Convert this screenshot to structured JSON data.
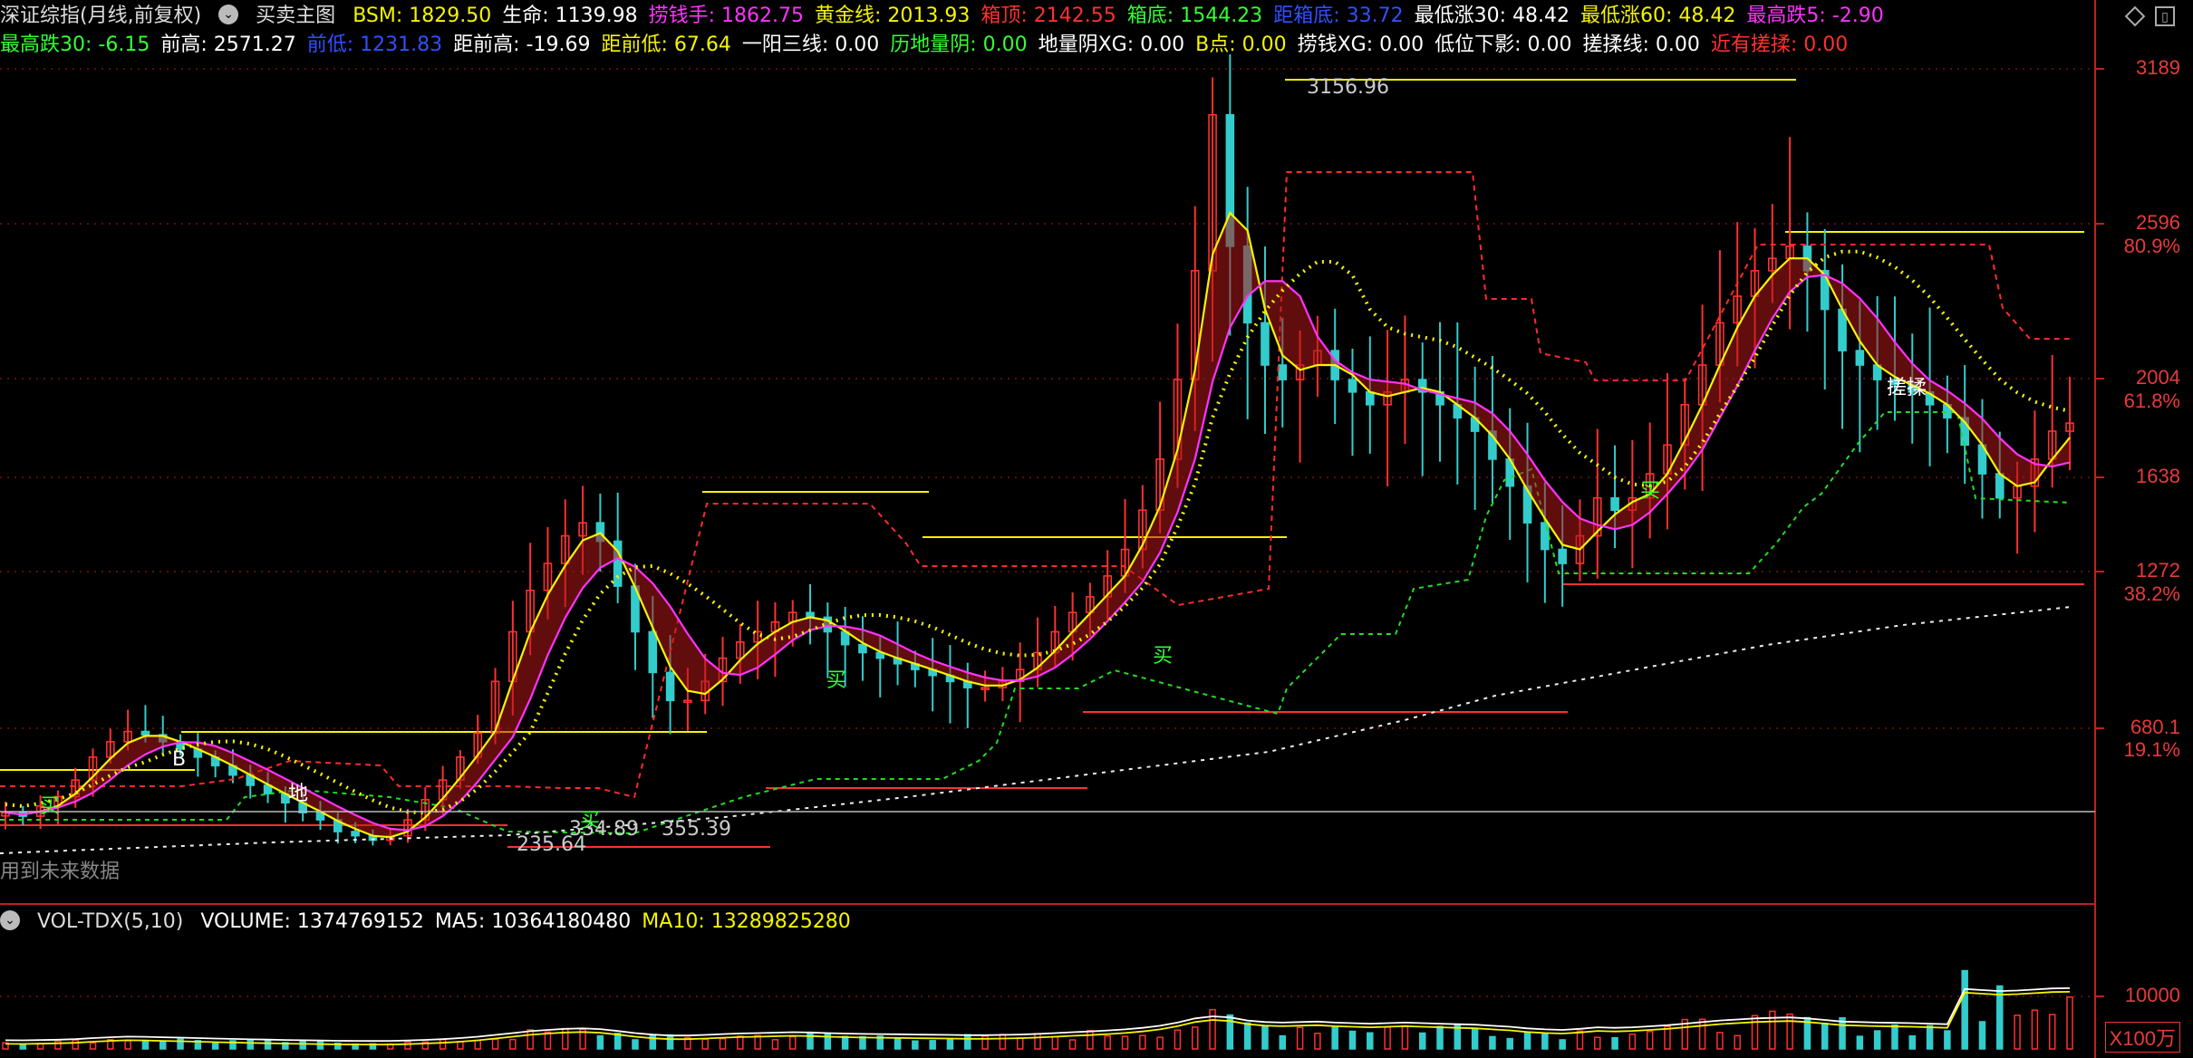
{
  "indicator_row1": {
    "title": "深证综指(月线,前复权)",
    "formula_name": "买卖主图",
    "items": [
      {
        "label": "BSM: ",
        "value": "1829.50",
        "color": "#f5f500"
      },
      {
        "label": "生命: ",
        "value": "1139.98",
        "color": "#ffffff"
      },
      {
        "label": "捞钱手: ",
        "value": "1862.75",
        "color": "#ff33ff"
      },
      {
        "label": "黄金线: ",
        "value": "2013.93",
        "color": "#f5f500"
      },
      {
        "label": "箱顶: ",
        "value": "2142.55",
        "color": "#ff3030"
      },
      {
        "label": "箱底: ",
        "value": "1544.23",
        "color": "#33ff33"
      },
      {
        "label": "距箱底: ",
        "value": "33.72",
        "color": "#3050ff"
      },
      {
        "label": "最低涨30: ",
        "value": "48.42",
        "color": "#ffffff"
      },
      {
        "label": "最低涨60: ",
        "value": "48.42",
        "color": "#f5f500"
      },
      {
        "label": "最高跌5: ",
        "value": "-2.90",
        "color": "#ff33ff"
      }
    ]
  },
  "indicator_row2": {
    "items": [
      {
        "label": "最高跌30: ",
        "value": "-6.15",
        "color": "#33ff33"
      },
      {
        "label": "前高: ",
        "value": "2571.27",
        "color": "#ffffff"
      },
      {
        "label": "前低: ",
        "value": "1231.83",
        "color": "#3050ff"
      },
      {
        "label": "距前高: ",
        "value": "-19.69",
        "color": "#ffffff"
      },
      {
        "label": "距前低: ",
        "value": "67.64",
        "color": "#f5f500"
      },
      {
        "label": "一阳三线: ",
        "value": "0.00",
        "color": "#ffffff"
      },
      {
        "label": "历地量阴: ",
        "value": "0.00",
        "color": "#33ff33"
      },
      {
        "label": "地量阴XG: ",
        "value": "0.00",
        "color": "#ffffff"
      },
      {
        "label": "B点: ",
        "value": "0.00",
        "color": "#f5f500"
      },
      {
        "label": "捞钱XG: ",
        "value": "0.00",
        "color": "#ffffff"
      },
      {
        "label": "低位下影: ",
        "value": "0.00",
        "color": "#ffffff"
      },
      {
        "label": "搓揉线: ",
        "value": "0.00",
        "color": "#ffffff"
      },
      {
        "label": "近有搓揉: ",
        "value": "0.00",
        "color": "#ff3030"
      }
    ]
  },
  "volume_header": {
    "name": "VOL-TDX(5,10)",
    "items": [
      {
        "label": "VOLUME: ",
        "value": "1374769152",
        "color": "#ffffff"
      },
      {
        "label": "MA5: ",
        "value": "10364180480",
        "color": "#ffffff"
      },
      {
        "label": "MA10: ",
        "value": "13289825280",
        "color": "#f5f500"
      }
    ]
  },
  "price_axis": [
    "3189",
    "2596",
    "2004",
    "1638",
    "1272",
    "680.1"
  ],
  "percent_axis": [
    "80.9%",
    "61.8%",
    "38.2%",
    "19.1%"
  ],
  "volume_axis": {
    "tick": "10000",
    "unit": "X100万"
  },
  "annotations": {
    "high_label": "3156.96",
    "low_label": "235.64",
    "low2_label": "334.89",
    "low3_label": "355.39",
    "future_data_note": "用到未来数据",
    "b_point": "B",
    "ground": "地",
    "buy": "买",
    "rub": "搓揉"
  },
  "icons": {
    "dropdown": "chevron-down-icon",
    "settings": "diamond-icon",
    "window": "window-icon"
  },
  "colors": {
    "up": "#ff3030",
    "down": "#33cccc",
    "ma_yellow": "#f5f500",
    "ma_magenta": "#ff33ff",
    "green_dash": "#22dd22",
    "white_dash": "#eeeeee"
  },
  "chart_data": {
    "type": "candlestick",
    "title": "深证综指(月线,前复权)",
    "price_ticks": [
      680.1,
      1272,
      1638,
      2004,
      2596,
      3189
    ],
    "percent_ticks": [
      "19.1%",
      "38.2%",
      "61.8%",
      "80.9%"
    ],
    "marked_high": 3156.96,
    "marked_low": 235.64,
    "series": [
      {
        "name": "BSM",
        "last": 1829.5
      },
      {
        "name": "生命",
        "last": 1139.98
      },
      {
        "name": "捞钱手",
        "last": 1862.75
      },
      {
        "name": "黄金线",
        "last": 2013.93
      },
      {
        "name": "箱顶",
        "last": 2142.55
      },
      {
        "name": "箱底",
        "last": 1544.23
      }
    ],
    "volume": {
      "last": 1374769152,
      "ma5": 10364180480,
      "ma10": 13289825280
    },
    "close_path": [
      310,
      300,
      330,
      360,
      420,
      520,
      600,
      660,
      640,
      600,
      560,
      520,
      480,
      440,
      400,
      370,
      340,
      310,
      290,
      260,
      250,
      240,
      250,
      290,
      350,
      420,
      520,
      650,
      820,
      1000,
      1180,
      1300,
      1400,
      1450,
      1380,
      1200,
      1000,
      850,
      760,
      760,
      820,
      900,
      960,
      1000,
      1040,
      1080,
      1060,
      1000,
      950,
      920,
      900,
      880,
      860,
      840,
      820,
      800,
      800,
      820,
      860,
      920,
      1000,
      1080,
      1150,
      1250,
      1350,
      1500,
      1700,
      2000,
      2400,
      3000,
      2500,
      2200,
      2050,
      2000,
      2050,
      2100,
      2000,
      1950,
      1900,
      1950,
      2000,
      1950,
      1900,
      1850,
      1800,
      1700,
      1600,
      1450,
      1350,
      1300,
      1400,
      1550,
      1500,
      1550,
      1650,
      1750,
      1900,
      2050,
      2200,
      2300,
      2400,
      2450,
      2500,
      2400,
      2250,
      2100,
      2050,
      2000,
      1980,
      1950,
      1900,
      1850,
      1750,
      1650,
      1550,
      1600,
      1700,
      1800,
      1830
    ]
  }
}
